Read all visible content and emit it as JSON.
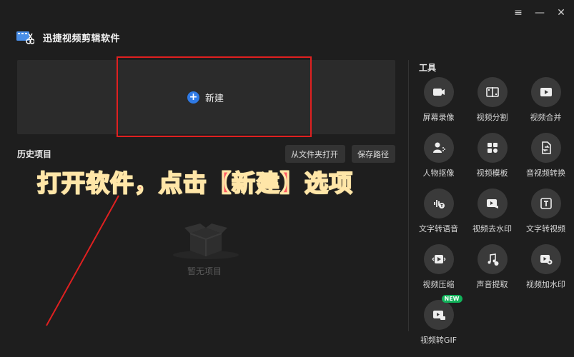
{
  "app": {
    "title": "迅捷视频剪辑软件"
  },
  "window_controls": {
    "menu": "≡",
    "minimize": "—",
    "close": "✕"
  },
  "new_project": {
    "label": "新建"
  },
  "history": {
    "title": "历史项目",
    "open_folder": "从文件夹打开",
    "save_path": "保存路径",
    "empty": "暂无项目"
  },
  "overlay": {
    "text": "打开软件，点击【新建】选项"
  },
  "tools": {
    "title": "工具",
    "items": [
      {
        "label": "屏幕录像",
        "icon": "camera-icon"
      },
      {
        "label": "视频分割",
        "icon": "film-split-icon"
      },
      {
        "label": "视频合并",
        "icon": "video-merge-icon"
      },
      {
        "label": "人物抠像",
        "icon": "person-cutout-icon"
      },
      {
        "label": "视频模板",
        "icon": "template-icon"
      },
      {
        "label": "音视频转换",
        "icon": "convert-icon"
      },
      {
        "label": "文字转语音",
        "icon": "text-to-speech-icon"
      },
      {
        "label": "视频去水印",
        "icon": "remove-watermark-icon"
      },
      {
        "label": "文字转视频",
        "icon": "text-to-video-icon"
      },
      {
        "label": "视频压缩",
        "icon": "compress-icon"
      },
      {
        "label": "声音提取",
        "icon": "music-extract-icon"
      },
      {
        "label": "视频加水印",
        "icon": "add-watermark-icon"
      },
      {
        "label": "视频转GIF",
        "icon": "gif-icon",
        "badge": "NEW"
      }
    ]
  },
  "colors": {
    "accent": "#2f7ae5",
    "highlight": "#e02020",
    "overlay": "#ff5a63",
    "badge": "#12b35b"
  }
}
